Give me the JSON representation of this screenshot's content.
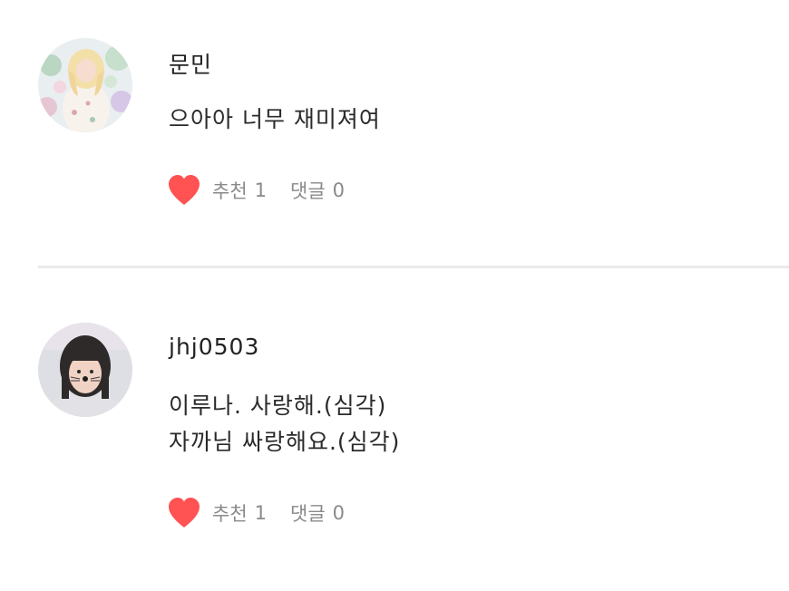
{
  "comments": [
    {
      "username": "문민",
      "lines": [
        "으아아 너무 재미져여"
      ],
      "like_label": "추천",
      "like_count": "1",
      "reply_label": "댓글",
      "reply_count": "0"
    },
    {
      "username": "jhj0503",
      "lines": [
        "이루나. 사랑해.(심각)",
        "자까님 싸랑해요.(심각)"
      ],
      "like_label": "추천",
      "like_count": "1",
      "reply_label": "댓글",
      "reply_count": "0"
    }
  ],
  "colors": {
    "heart": "#ff5252",
    "divider": "#eaeaea",
    "meta_text": "#8a8a8a"
  },
  "icons": {
    "like": "heart-icon"
  }
}
